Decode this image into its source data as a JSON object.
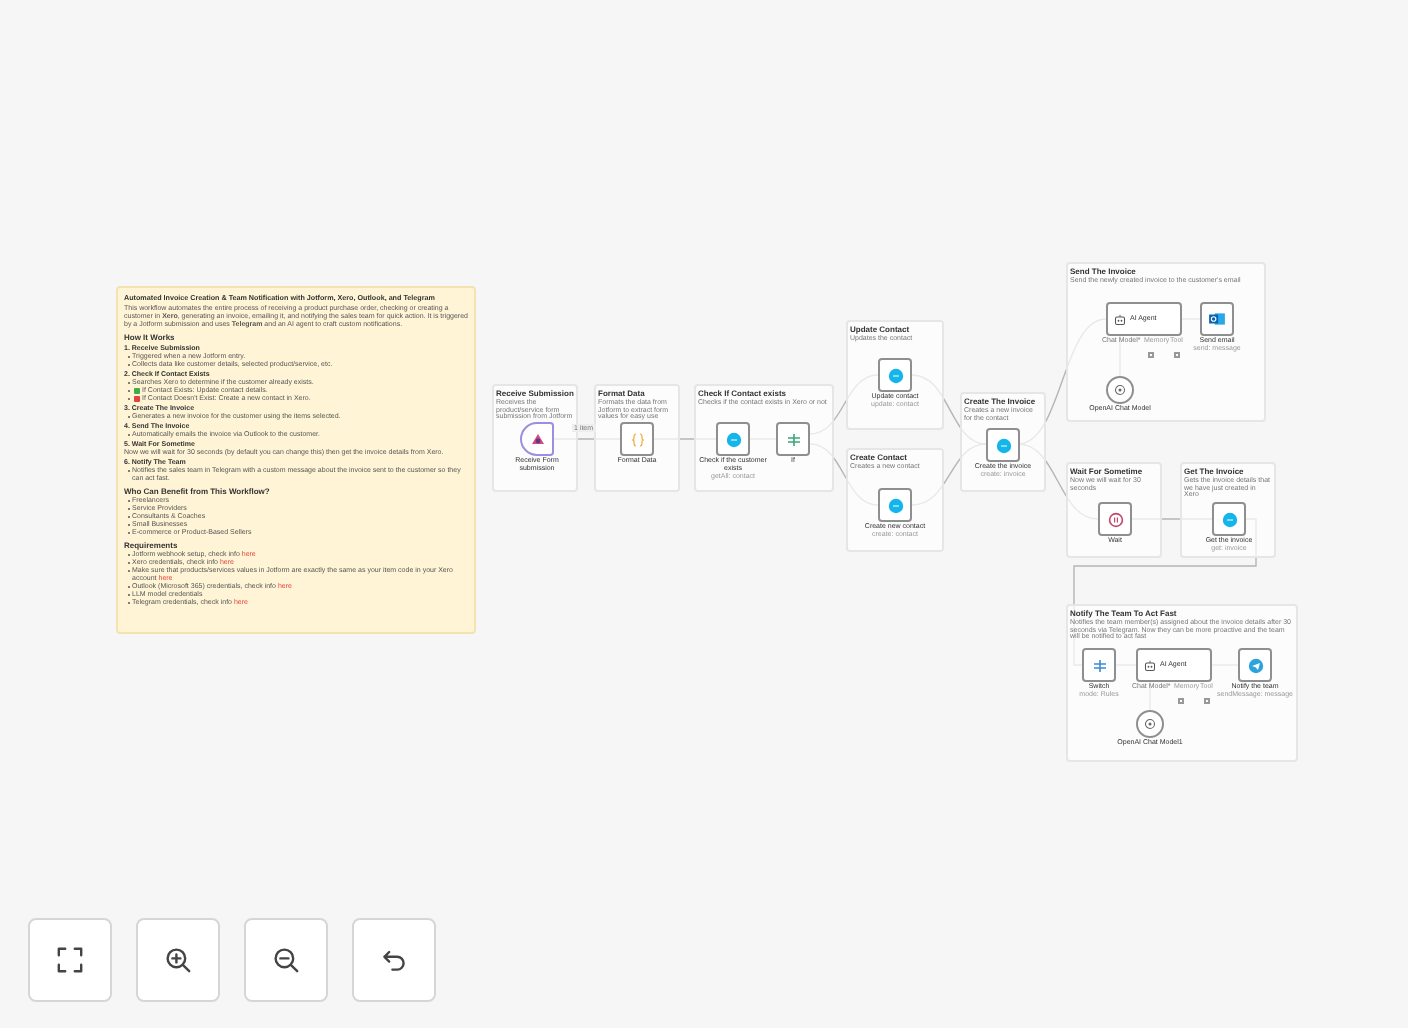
{
  "sticky_note": {
    "title": "Automated Invoice Creation & Team Notification with Jotform, Xero, Outlook, and Telegram",
    "intro": "This workflow automates the entire process of receiving a product purchase order, checking or creating a customer in **Xero**, generating an invoice, emailing it, and notifying the sales team for quick action. It is triggered by a Jotform submission and uses **Telegram** and an AI agent to craft custom notifications.",
    "blocks": [
      {
        "kind": "heading",
        "text": "How It Works"
      },
      {
        "kind": "step",
        "text": "1. Receive Submission"
      },
      {
        "kind": "bullet",
        "text": "Triggered when a new Jotform entry."
      },
      {
        "kind": "bullet",
        "text": "Collects data like customer details, selected product/service, etc."
      },
      {
        "kind": "step",
        "text": "2. Check If Contact Exists"
      },
      {
        "kind": "bullet",
        "text": "Searches Xero to determine if the customer already exists."
      },
      {
        "kind": "yes",
        "text": "If Contact Exists: Update contact details."
      },
      {
        "kind": "no",
        "text": "If Contact Doesn't Exist: Create a new contact in Xero."
      },
      {
        "kind": "step",
        "text": "3. Create The Invoice"
      },
      {
        "kind": "bullet",
        "text": "Generates a new invoice for the customer using the items selected."
      },
      {
        "kind": "step",
        "text": "4. Send The Invoice"
      },
      {
        "kind": "bullet",
        "text": "Automatically emails the invoice via Outlook to the customer."
      },
      {
        "kind": "step",
        "text": "5. Wait For Sometime"
      },
      {
        "kind": "para",
        "text": "Now we will wait for 30 seconds (by default you can change this) then get the invoice details from Xero."
      },
      {
        "kind": "step",
        "text": "6. Notify The Team"
      },
      {
        "kind": "bullet",
        "text": "Notifies the sales team in Telegram with a custom message about the invoice sent to the customer so they can act fast."
      },
      {
        "kind": "heading",
        "text": "Who Can Benefit from This Workflow?"
      },
      {
        "kind": "bullet",
        "text": "Freelancers"
      },
      {
        "kind": "bullet",
        "text": "Service Providers"
      },
      {
        "kind": "bullet",
        "text": "Consultants & Coaches"
      },
      {
        "kind": "bullet",
        "text": "Small Businesses"
      },
      {
        "kind": "bullet",
        "text": "E-commerce or Product-Based Sellers"
      },
      {
        "kind": "heading",
        "text": "Requirements"
      },
      {
        "kind": "bullet",
        "text": "Jotform webhook setup, check info",
        "link": "here"
      },
      {
        "kind": "bullet",
        "text": "Xero credentials, check info",
        "link": "here"
      },
      {
        "kind": "bullet",
        "text": "Make sure that products/services values in Jotform are exactly the same as your item code in your Xero account",
        "link": "here"
      },
      {
        "kind": "bullet",
        "text": "Outlook (Microsoft 365) credentials, check info",
        "link": "here"
      },
      {
        "kind": "bullet",
        "text": "LLM model credentials"
      },
      {
        "kind": "bullet",
        "text": "Telegram credentials, check info",
        "link": "here"
      }
    ]
  },
  "edge_label": "1 item",
  "groups": [
    {
      "title": "Receive Submission",
      "description": "Receives the product/service form submission from Jotform",
      "nodes": [
        {
          "kind": "trigger",
          "label": "Receive Form submission"
        }
      ]
    },
    {
      "title": "Format Data",
      "description": "Formats the data from Jotform to extract form values for easy use",
      "nodes": [
        {
          "kind": "code",
          "label": "Format Data"
        }
      ]
    },
    {
      "title": "Check If Contact exists",
      "description": "Checks if the contact exists in Xero or not",
      "nodes": [
        {
          "kind": "xero",
          "label": "Check if the customer exists",
          "sublabel": "getAll: contact"
        },
        {
          "kind": "if",
          "label": "If"
        }
      ]
    },
    {
      "title": "Update Contact",
      "description": "Updates the contact",
      "nodes": [
        {
          "kind": "xero",
          "label": "Update contact",
          "sublabel": "update: contact"
        }
      ]
    },
    {
      "title": "Create Contact",
      "description": "Creates a new contact",
      "nodes": [
        {
          "kind": "xero",
          "label": "Create new contact",
          "sublabel": "create: contact"
        }
      ]
    },
    {
      "title": "Create The Invoice",
      "description": "Creates a new invoice for the contact",
      "nodes": [
        {
          "kind": "xero",
          "label": "Create the invoice",
          "sublabel": "create: invoice"
        }
      ]
    },
    {
      "title": "Send The Invoice",
      "description": "Send the newly created invoice to the customer's email",
      "nodes": [
        {
          "kind": "agent",
          "label": "AI Agent",
          "ports": [
            "Chat Model*",
            "Memory",
            "Tool"
          ]
        },
        {
          "kind": "outlook",
          "label": "Send email",
          "sublabel": "send: message"
        },
        {
          "kind": "model",
          "label": "OpenAI Chat Model"
        }
      ]
    },
    {
      "title": "Wait For Sometime",
      "description": "Now we will wait for 30 seconds",
      "nodes": [
        {
          "kind": "wait",
          "label": "Wait"
        }
      ]
    },
    {
      "title": "Get The Invoice",
      "description": "Gets the invoice details that we have just created in Xero",
      "nodes": [
        {
          "kind": "xero",
          "label": "Get the invoice",
          "sublabel": "get: invoice"
        }
      ]
    },
    {
      "title": "Notify The Team To Act Fast",
      "description": "Notifies the team member(s) assigned about the invoice details after 30 seconds via Telegram. Now they can be more proactive and the team will be notified to act fast",
      "nodes": [
        {
          "kind": "switch",
          "label": "Switch",
          "sublabel": "mode: Rules"
        },
        {
          "kind": "agent",
          "label": "AI Agent",
          "ports": [
            "Chat Model*",
            "Memory",
            "Tool"
          ]
        },
        {
          "kind": "telegram",
          "label": "Notify the team",
          "sublabel": "sendMessage: message"
        },
        {
          "kind": "model",
          "label": "OpenAI Chat Model1"
        }
      ]
    }
  ],
  "controls": [
    {
      "kind": "fit"
    },
    {
      "kind": "zoom_in"
    },
    {
      "kind": "zoom_out"
    },
    {
      "kind": "undo"
    }
  ]
}
